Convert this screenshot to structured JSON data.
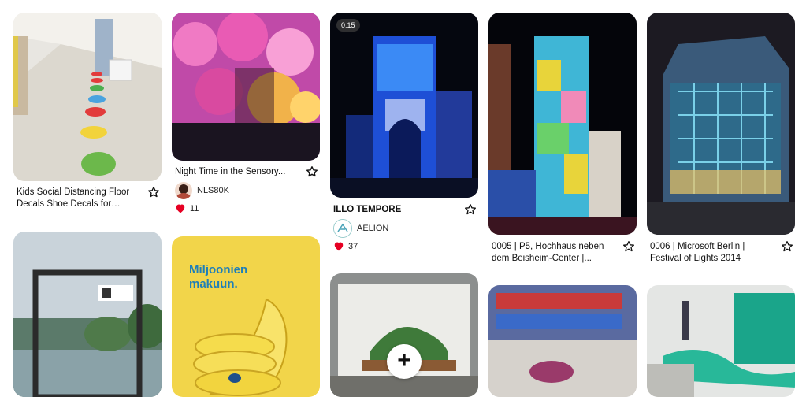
{
  "pins": [
    {
      "title": "Kids Social Distancing Floor Decals Shoe Decals for Floor..."
    },
    {
      "title": "Night Time in the Sensory...",
      "author": "NLS80K",
      "likes": "11"
    },
    {
      "title": "ILLO TEMPORE",
      "author": "AELION",
      "likes": "37",
      "video_duration": "0:15"
    },
    {
      "title": "0005 | P5, Hochhaus neben dem Beisheim-Center |..."
    },
    {
      "title": "0006 | Microsoft Berlin | Festival of Lights 2014"
    },
    {
      "ad_text": "Miljoonien makuun."
    }
  ],
  "fab": {
    "icon": "plus-icon"
  },
  "colors": {
    "heart": "#e60023",
    "ad_blue": "#1f7fb8"
  }
}
